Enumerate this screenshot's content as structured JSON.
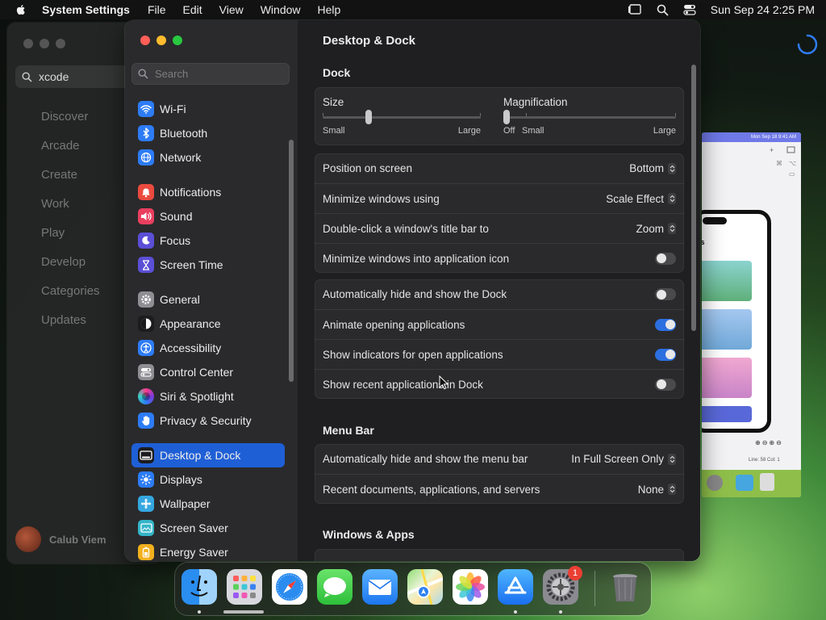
{
  "menubar": {
    "app": "System Settings",
    "items": [
      "File",
      "Edit",
      "View",
      "Window",
      "Help"
    ],
    "clock": "Sun Sep 24  2:25 PM"
  },
  "bg_window": {
    "search_value": "xcode",
    "nav": [
      "Discover",
      "Arcade",
      "Create",
      "Work",
      "Play",
      "Develop",
      "Categories",
      "Updates"
    ],
    "user": "Calub Viem"
  },
  "preview": {
    "status": "Mon Sep 18  9:41 AM",
    "heading_fragment": "ds",
    "zoom_controls": "⊕⊖⊕⊖",
    "footer": "Line: 58  Col: 1"
  },
  "sidebar": {
    "search_placeholder": "Search",
    "items": [
      {
        "label": "Wi-Fi",
        "icon": "wifi-icon",
        "color": "#2d7cf6"
      },
      {
        "label": "Bluetooth",
        "icon": "bluetooth-icon",
        "color": "#2d7cf6"
      },
      {
        "label": "Network",
        "icon": "globe-icon",
        "color": "#2d7cf6"
      },
      {
        "label": "Notifications",
        "icon": "bell-icon",
        "color": "#eb4b3f"
      },
      {
        "label": "Sound",
        "icon": "speaker-icon",
        "color": "#ea3f5f"
      },
      {
        "label": "Focus",
        "icon": "moon-icon",
        "color": "#5b4fd6"
      },
      {
        "label": "Screen Time",
        "icon": "hourglass-icon",
        "color": "#5b4fd6"
      },
      {
        "label": "General",
        "icon": "gear-icon",
        "color": "#8e8e93"
      },
      {
        "label": "Appearance",
        "icon": "appearance-icon",
        "color": "#1c1c1e"
      },
      {
        "label": "Accessibility",
        "icon": "accessibility-icon",
        "color": "#2d7cf6"
      },
      {
        "label": "Control Center",
        "icon": "control-center-icon",
        "color": "#8e8e93"
      },
      {
        "label": "Siri & Spotlight",
        "icon": "siri-icon",
        "color": "#7a3ad8"
      },
      {
        "label": "Privacy & Security",
        "icon": "hand-icon",
        "color": "#2d7cf6"
      },
      {
        "label": "Desktop & Dock",
        "icon": "dock-icon",
        "color": "#1c1c1e"
      },
      {
        "label": "Displays",
        "icon": "sun-icon",
        "color": "#2d7cf6"
      },
      {
        "label": "Wallpaper",
        "icon": "wallpaper-icon",
        "color": "#35a7e0"
      },
      {
        "label": "Screen Saver",
        "icon": "screensaver-icon",
        "color": "#35b5c9"
      },
      {
        "label": "Energy Saver",
        "icon": "battery-icon",
        "color": "#f2b01e"
      }
    ],
    "selected": "Desktop & Dock"
  },
  "content": {
    "title": "Desktop & Dock",
    "dock_section": "Dock",
    "size_slider": {
      "label": "Size",
      "min_label": "Small",
      "max_label": "Large",
      "value": 0.28
    },
    "magnification_slider": {
      "label": "Magnification",
      "off_label": "Off",
      "min_label": "Small",
      "max_label": "Large",
      "value": 0.0
    },
    "dock_rows": [
      {
        "label": "Position on screen",
        "value": "Bottom"
      },
      {
        "label": "Minimize windows using",
        "value": "Scale Effect"
      },
      {
        "label": "Double-click a window's title bar to",
        "value": "Zoom"
      },
      {
        "label": "Minimize windows into application icon",
        "toggle": false
      }
    ],
    "behavior_rows": [
      {
        "label": "Automatically hide and show the Dock",
        "toggle": false
      },
      {
        "label": "Animate opening applications",
        "toggle": true
      },
      {
        "label": "Show indicators for open applications",
        "toggle": true
      },
      {
        "label": "Show recent applications in Dock",
        "toggle": false
      }
    ],
    "menubar_section": "Menu Bar",
    "menubar_rows": [
      {
        "label": "Automatically hide and show the menu bar",
        "value": "In Full Screen Only"
      },
      {
        "label": "Recent documents, applications, and servers",
        "value": "None"
      }
    ],
    "windows_section": "Windows & Apps"
  },
  "dock": {
    "apps": [
      "Finder",
      "Launchpad",
      "Safari",
      "Messages",
      "Mail",
      "Maps",
      "Photos",
      "App Store",
      "System Settings",
      "Trash"
    ],
    "settings_badge": "1"
  },
  "colors": {
    "accent": "#1f5fd6",
    "toggle_on": "#2c6fe0",
    "close": "#ff5f57",
    "minimize": "#febc2e",
    "zoom": "#28c840"
  }
}
